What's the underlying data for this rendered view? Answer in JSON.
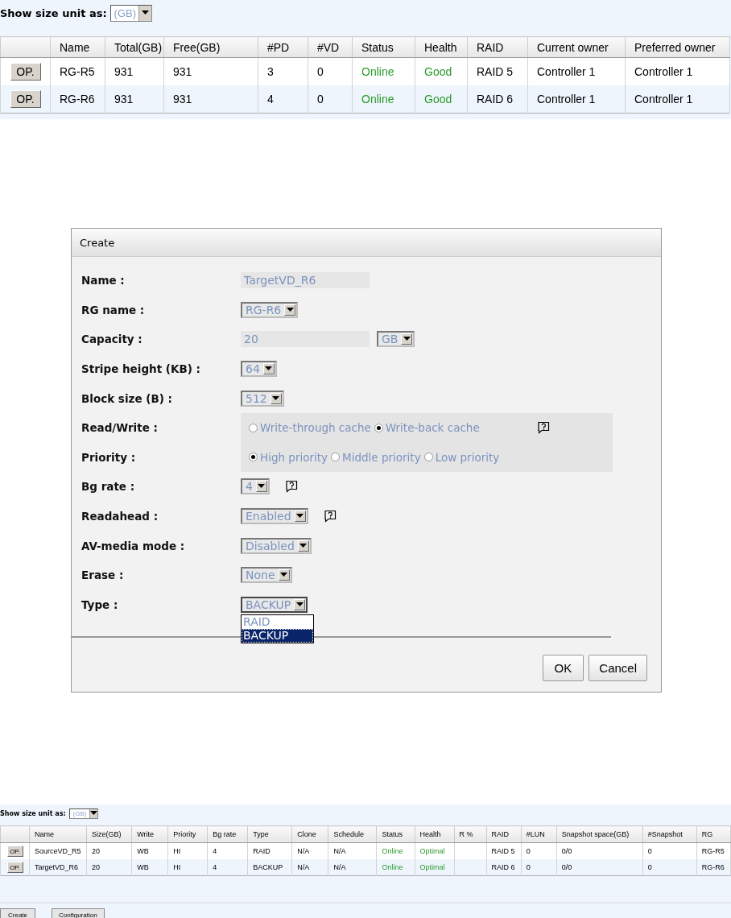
{
  "raid_group_panel": {
    "unit_label": "Show size unit as:",
    "unit_value": "(GB)",
    "columns": [
      {
        "label": "Name",
        "kind": "text"
      },
      {
        "label": "Total(GB)",
        "kind": "text"
      },
      {
        "label": "Free(GB)",
        "kind": "text"
      },
      {
        "label": "#PD",
        "kind": "text"
      },
      {
        "label": "#VD",
        "kind": "text"
      },
      {
        "label": "Status",
        "kind": "status"
      },
      {
        "label": "Health",
        "kind": "status"
      },
      {
        "label": "RAID",
        "kind": "text"
      },
      {
        "label": "Current owner",
        "kind": "text"
      },
      {
        "label": "Preferred owner",
        "kind": "text"
      }
    ],
    "rows": [
      {
        "action": "OP.",
        "cells": [
          "RG-R5",
          "931",
          "931",
          "3",
          "0",
          "Online",
          "Good",
          "RAID 5",
          "Controller 1",
          "Controller 1"
        ]
      },
      {
        "action": "OP.",
        "cells": [
          "RG-R6",
          "931",
          "931",
          "4",
          "0",
          "Online",
          "Good",
          "RAID 6",
          "Controller 1",
          "Controller 1"
        ]
      }
    ]
  },
  "dialog": {
    "title": "Create",
    "fields": [
      {
        "label": "Name :",
        "kind": "text",
        "value": "TargetVD_R6",
        "help": false
      },
      {
        "label": "RG name :",
        "kind": "select",
        "value": "RG-R6",
        "expanded": false,
        "help": false
      },
      {
        "label": "Capacity :",
        "kind": "text",
        "value": "20",
        "unit": "GB",
        "help": false
      },
      {
        "label": "Stripe height (KB) :",
        "kind": "select",
        "value": "64",
        "expanded": false,
        "help": false
      },
      {
        "label": "Block size (B) :",
        "kind": "select",
        "value": "512",
        "expanded": false,
        "help": false
      },
      {
        "label": "Read/Write :",
        "kind": "radio",
        "options": [
          {
            "label": "Write-through cache",
            "selected": false
          },
          {
            "label": "Write-back cache",
            "selected": true
          }
        ],
        "help": true
      },
      {
        "label": "Priority :",
        "kind": "radio",
        "options": [
          {
            "label": "High priority",
            "selected": true
          },
          {
            "label": "Middle priority",
            "selected": false
          },
          {
            "label": "Low priority",
            "selected": false
          }
        ],
        "help": false
      },
      {
        "label": "Bg rate :",
        "kind": "select",
        "value": "4",
        "expanded": false,
        "help": true
      },
      {
        "label": "Readahead :",
        "kind": "select",
        "value": "Enabled",
        "expanded": false,
        "help": true
      },
      {
        "label": "AV-media mode :",
        "kind": "select",
        "value": "Disabled",
        "expanded": false,
        "help": false
      },
      {
        "label": "Erase :",
        "kind": "select",
        "value": "None",
        "expanded": false,
        "help": false
      },
      {
        "label": "Type :",
        "kind": "select",
        "value": "BACKUP",
        "expanded": true,
        "help": false,
        "options": [
          {
            "label": "RAID",
            "selected": false
          },
          {
            "label": "BACKUP",
            "selected": true
          }
        ]
      }
    ],
    "buttons": [
      "OK",
      "Cancel"
    ]
  },
  "virtual_disk_panel": {
    "unit_label": "Show size unit as:",
    "unit_value": "(GB)",
    "columns": [
      {
        "label": "Name",
        "kind": "text"
      },
      {
        "label": "Size(GB)",
        "kind": "text"
      },
      {
        "label": "Write",
        "kind": "text"
      },
      {
        "label": "Priority",
        "kind": "text"
      },
      {
        "label": "Bg rate",
        "kind": "text"
      },
      {
        "label": "Type",
        "kind": "text"
      },
      {
        "label": "Clone",
        "kind": "text"
      },
      {
        "label": "Schedule",
        "kind": "text"
      },
      {
        "label": "Status",
        "kind": "status"
      },
      {
        "label": "Health",
        "kind": "status"
      },
      {
        "label": "R %",
        "kind": "text"
      },
      {
        "label": "RAID",
        "kind": "text"
      },
      {
        "label": "#LUN",
        "kind": "text"
      },
      {
        "label": "Snapshot space(GB)",
        "kind": "text"
      },
      {
        "label": "#Snapshot",
        "kind": "text"
      },
      {
        "label": "RG",
        "kind": "text"
      }
    ],
    "rows": [
      {
        "action": "OP.",
        "cells": [
          "SourceVD_R5",
          "20",
          "WB",
          "HI",
          "4",
          "RAID",
          "N/A",
          "N/A",
          "Online",
          "Optimal",
          null,
          "RAID 5",
          "0",
          "0/0",
          "0",
          "RG-R5"
        ]
      },
      {
        "action": "OP.",
        "cells": [
          "TargetVD_R6",
          "20",
          "WB",
          "HI",
          "4",
          "BACKUP",
          "N/A",
          "N/A",
          "Online",
          "Optimal",
          null,
          "RAID 6",
          "0",
          "0/0",
          "0",
          "RG-R6"
        ]
      }
    ],
    "footer_buttons": [
      "Create",
      "Configuration"
    ]
  }
}
